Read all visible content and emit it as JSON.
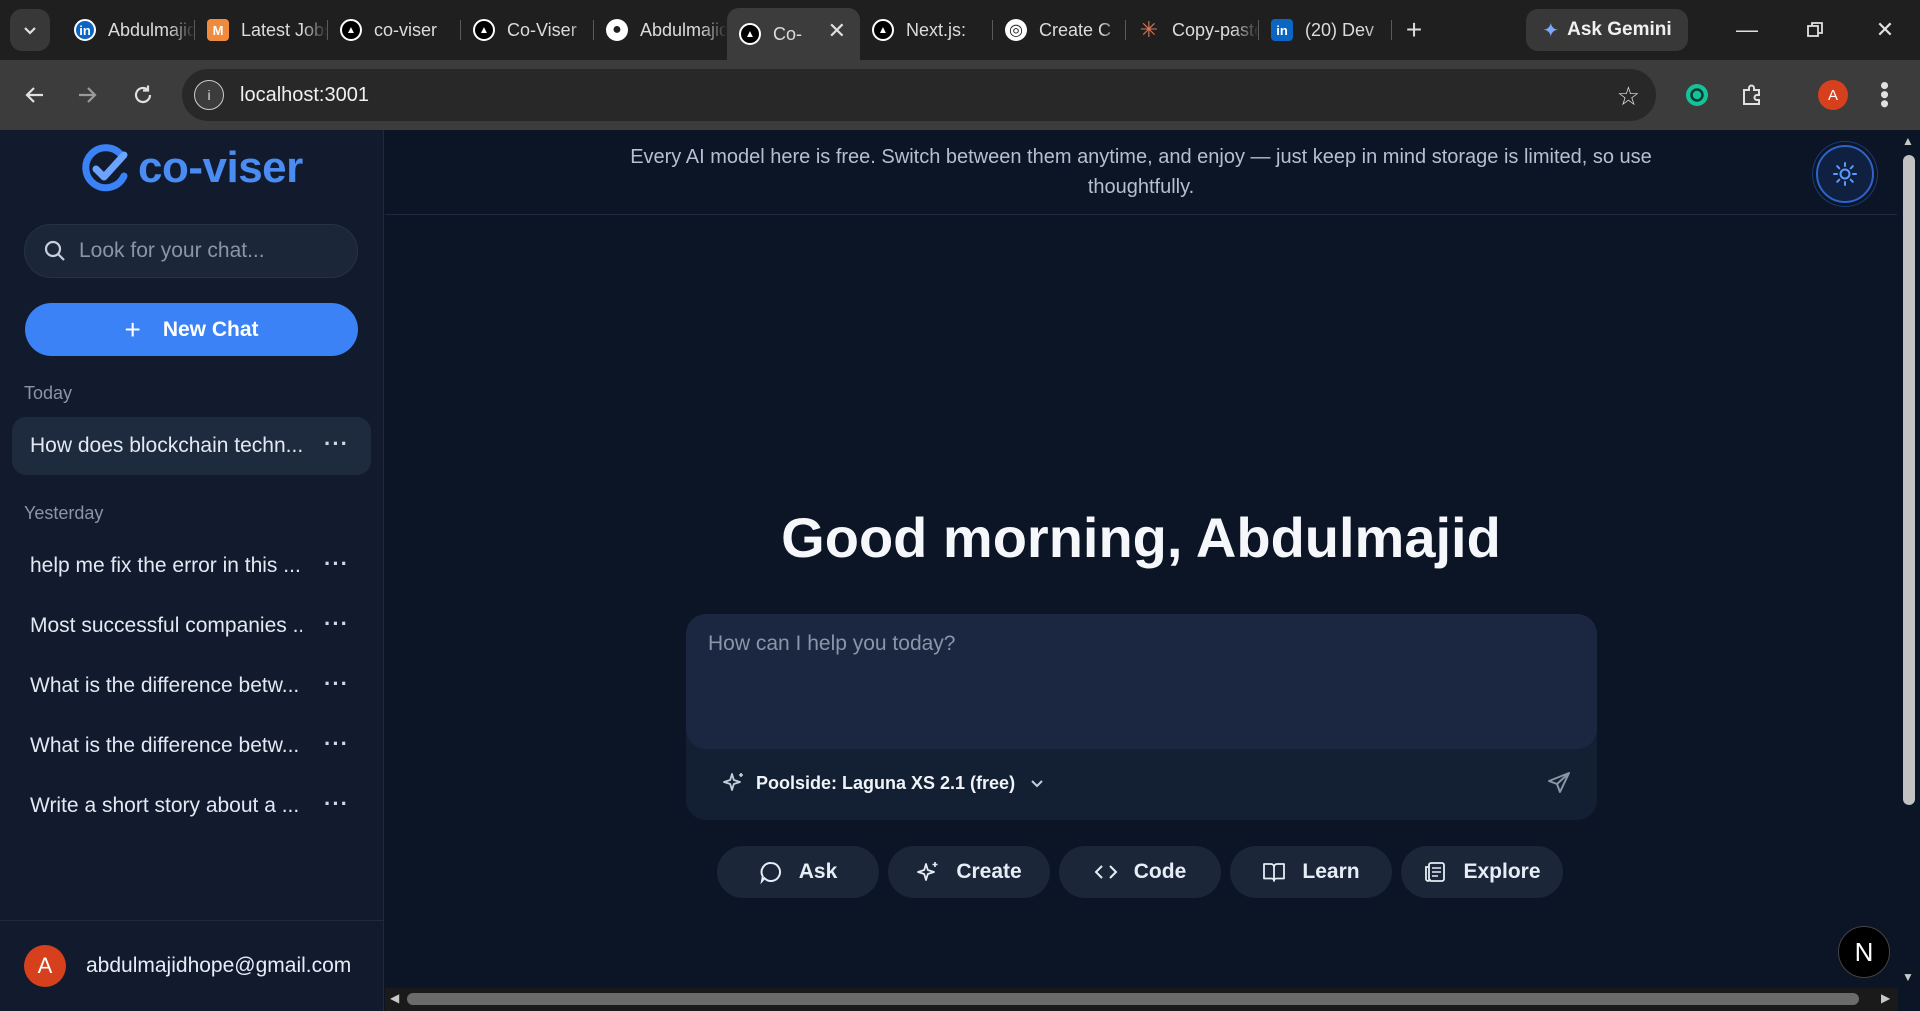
{
  "browser": {
    "tabs": [
      {
        "label": "Abdulmajid",
        "icon": "linkedin-icon",
        "fav_bg": "#0a66c2",
        "fav_glyph": "in"
      },
      {
        "label": "Latest Jobs",
        "icon": "medium-icon",
        "fav_bg": "#f08a3c",
        "fav_glyph": "M"
      },
      {
        "label": "co-viser",
        "icon": "vercel-icon",
        "fav_bg": "#000000",
        "fav_glyph": "▲"
      },
      {
        "label": "Co-Viser",
        "icon": "vercel-icon",
        "fav_bg": "#000000",
        "fav_glyph": "▲"
      },
      {
        "label": "Abdulmajid",
        "icon": "github-icon",
        "fav_bg": "#ffffff",
        "fav_glyph": "●"
      },
      {
        "label": "Co-",
        "icon": "vercel-icon",
        "fav_bg": "#000000",
        "fav_glyph": "▲",
        "active": true
      },
      {
        "label": "Next.js:",
        "icon": "vercel-icon",
        "fav_bg": "#000000",
        "fav_glyph": "▲"
      },
      {
        "label": "Create C",
        "icon": "openai-icon",
        "fav_bg": "#ffffff",
        "fav_glyph": "◎"
      },
      {
        "label": "Copy-paste",
        "icon": "claude-icon",
        "fav_bg": "#d97757",
        "fav_glyph": "✳"
      },
      {
        "label": "(20) Dev",
        "icon": "linkedin-icon",
        "fav_bg": "#0a66c2",
        "fav_glyph": "in"
      }
    ],
    "gemini_label": "Ask Gemini",
    "url": "localhost:3001",
    "profile_initial": "A"
  },
  "sidebar": {
    "brand": "co-viser",
    "search_placeholder": "Look for your chat...",
    "new_chat_label": "New Chat",
    "groups": [
      {
        "label": "Today",
        "items": [
          "How does blockchain techn..."
        ]
      },
      {
        "label": "Yesterday",
        "items": [
          "help me fix the error in this ...",
          "Most successful companies ...",
          "What is the difference betw...",
          "What is the difference betw...",
          "Write a short story about a ..."
        ]
      }
    ],
    "user_initial": "A",
    "user_email": "abdulmajidhope@gmail.com"
  },
  "main": {
    "banner": "Every AI model here is free. Switch between them anytime, and enjoy — just keep in mind storage is limited, so use thoughtfully.",
    "greeting": "Good morning, Abdulmajid",
    "prompt_placeholder": "How can I help you today?",
    "model": "Poolside: Laguna XS 2.1 (free)",
    "actions": [
      "Ask",
      "Create",
      "Code",
      "Learn",
      "Explore"
    ],
    "dev_badge": "N"
  },
  "colors": {
    "accent": "#3b82f6",
    "sidebar_bg": "#111b2d",
    "page_bg": "#0b1526",
    "avatar": "#d6401c"
  }
}
